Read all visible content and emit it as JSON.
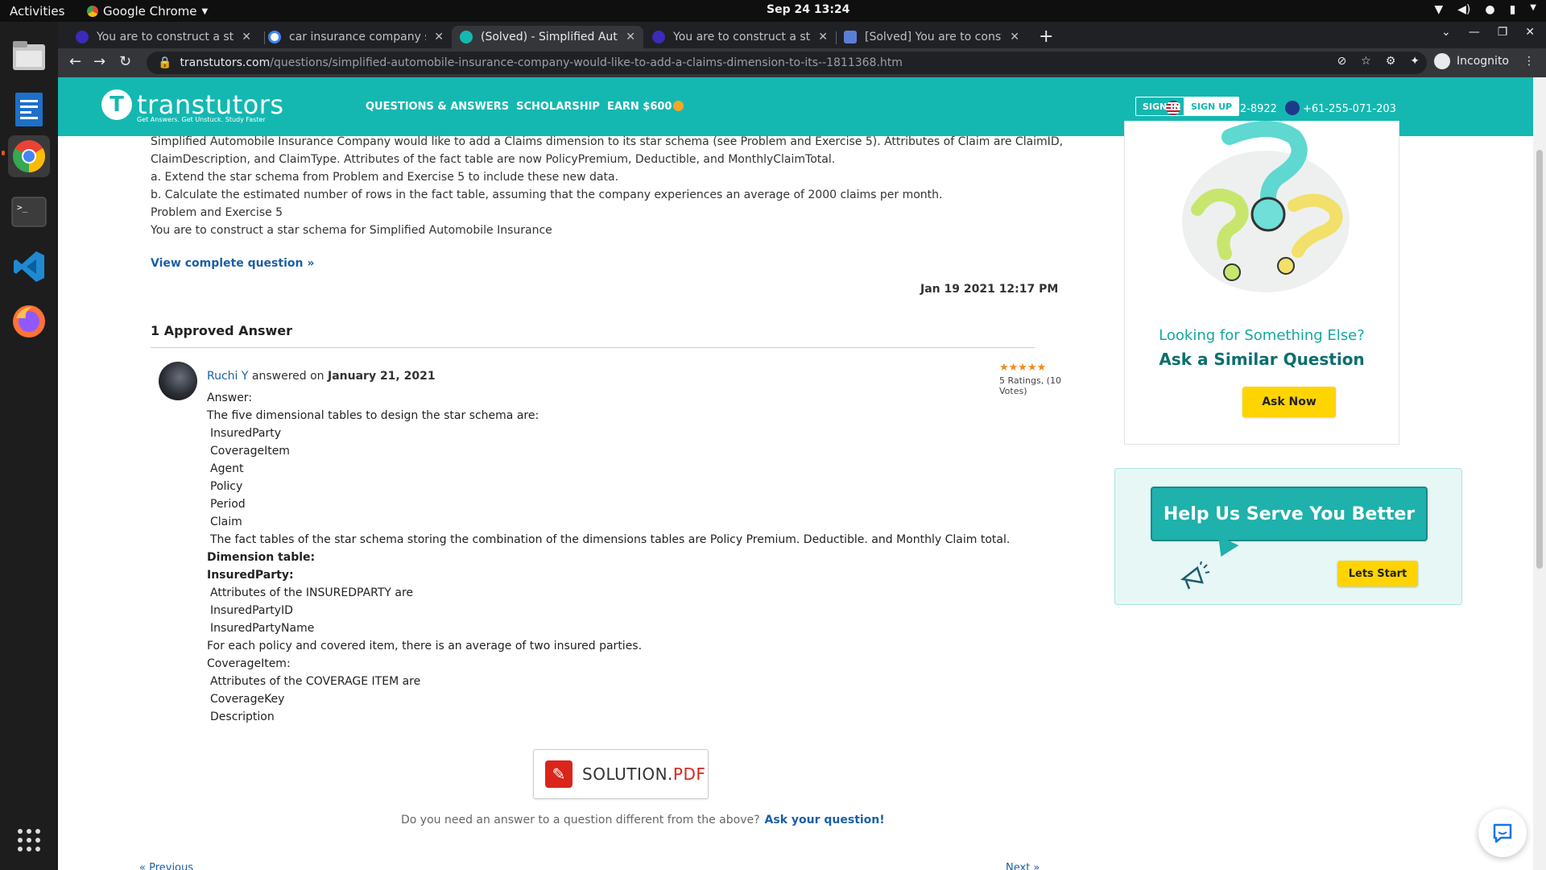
{
  "system": {
    "activities": "Activities",
    "app_name": "Google Chrome",
    "clock": "Sep 24  13:24"
  },
  "browser": {
    "tabs": [
      {
        "title": "You are to construct a sta",
        "favicon_color": "#3b2bb8"
      },
      {
        "title": "car insurance company st",
        "favicon_color": "#ffffff"
      },
      {
        "title": "(Solved) - Simplified Autor",
        "favicon_color": "#14b8b1",
        "active": true
      },
      {
        "title": "You are to construct a sta",
        "favicon_color": "#3b2bb8"
      },
      {
        "title": "[Solved] You are to constr",
        "favicon_color": "#5b7fd6"
      }
    ],
    "url_host": "transtutors.com",
    "url_path": "/questions/simplified-automobile-insurance-company-would-like-to-add-a-claims-dimension-to-its--1811368.htm",
    "incognito_label": "Incognito"
  },
  "site": {
    "logo_text": "transtutors",
    "logo_tagline": "Get Answers. Get Unstuck. Study Faster",
    "nav": [
      "QUESTIONS & ANSWERS",
      "SCHOLARSHIP",
      "EARN $600"
    ],
    "phone_us": "+1-559-702-8922",
    "phone_au": "+61-255-071-203",
    "sign_in": "SIGN IN",
    "sign_up": "SIGN UP"
  },
  "question": {
    "lines": [
      "Simplified Automobile Insurance Company would like to add a Claims dimension to its star schema (see Problem and Exercise 5). Attributes of Claim are ClaimID,",
      "ClaimDescription, and ClaimType. Attributes of the fact table are now PolicyPremium, Deductible, and MonthlyClaimTotal.",
      "a. Extend the star schema from Problem and Exercise 5 to include these new data.",
      "b. Calculate the estimated number of rows in the fact table, assuming that the company experiences an average of 2000 claims per month.",
      "Problem and Exercise 5",
      "You are to construct a star schema for Simplified Automobile Insurance"
    ],
    "view_link": "View complete question »",
    "date": "Jan 19 2021 12:17 PM"
  },
  "answers": {
    "heading": "1 Approved Answer",
    "author": "Ruchi Y",
    "answered_on_label": "answered on",
    "answered_date": "January 21, 2021",
    "stars": "★★★★★",
    "rating_text": "5 Ratings, (10 Votes)",
    "body": [
      {
        "text": "Answer:",
        "style": ""
      },
      {
        "text": "The five dimensional tables to design the star schema are:",
        "style": ""
      },
      {
        "text": "InsuredParty",
        "style": "ind"
      },
      {
        "text": "CoverageItem",
        "style": "ind"
      },
      {
        "text": "Agent",
        "style": "ind"
      },
      {
        "text": "Policy",
        "style": "ind"
      },
      {
        "text": "Period",
        "style": "ind"
      },
      {
        "text": "Claim",
        "style": "ind"
      },
      {
        "text": "The fact tables of the star schema storing the combination of the dimensions tables are Policy Premium. Deductible. and Monthly Claim total.",
        "style": "ind"
      },
      {
        "text": "Dimension table:",
        "style": "b"
      },
      {
        "text": "InsuredParty:",
        "style": "b"
      },
      {
        "text": "Attributes of the INSUREDPARTY are",
        "style": "ind"
      },
      {
        "text": "InsuredPartyID",
        "style": "ind"
      },
      {
        "text": "InsuredPartyName",
        "style": "ind"
      },
      {
        "text": "For each policy and covered item, there is an average of two insured parties.",
        "style": ""
      },
      {
        "text": "CoverageItem:",
        "style": ""
      },
      {
        "text": "Attributes of the COVERAGE ITEM are",
        "style": "ind"
      },
      {
        "text": "CoverageKey",
        "style": "ind"
      },
      {
        "text": "Description",
        "style": "ind"
      }
    ],
    "pdf_label_main": "SOLUTION.",
    "pdf_label_ext": "PDF",
    "ask_prompt": "Do you need an answer to a question different from the above?",
    "ask_link": "Ask your question!",
    "prev": "« Previous",
    "next": "Next »"
  },
  "sidebar": {
    "looking": "Looking for Something Else?",
    "similar": "Ask a Similar Question",
    "ask_now": "Ask Now",
    "help_title": "Help Us Serve You Better",
    "lets_start": "Lets Start"
  }
}
